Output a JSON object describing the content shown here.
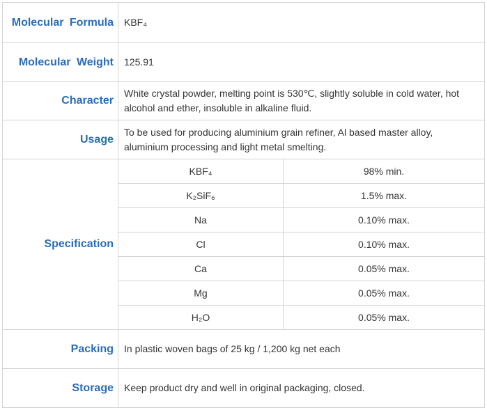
{
  "rows": {
    "formula": {
      "label": "Molecular  Formula",
      "value": "KBF₄"
    },
    "weight": {
      "label": "Molecular  Weight",
      "value": "125.91"
    },
    "character": {
      "label": "Character",
      "value": "White crystal powder, melting point is 530℃, slightly soluble in cold water, hot alcohol and ether, insoluble in alkaline fluid."
    },
    "usage": {
      "label": "Usage",
      "value": "To be used for producing aluminium grain refiner, Al based master alloy, aluminium processing and light metal smelting."
    },
    "specification": {
      "label": "Specification",
      "items": [
        {
          "name": "KBF₄",
          "value": "98% min."
        },
        {
          "name": "K₂SiF₆",
          "value": "1.5% max."
        },
        {
          "name": "Na",
          "value": "0.10% max."
        },
        {
          "name": "Cl",
          "value": "0.10% max."
        },
        {
          "name": "Ca",
          "value": "0.05% max."
        },
        {
          "name": "Mg",
          "value": "0.05% max."
        },
        {
          "name": "H₂O",
          "value": "0.05% max."
        }
      ]
    },
    "packing": {
      "label": "Packing",
      "value": "In plastic woven bags of 25 kg / 1,200 kg net each"
    },
    "storage": {
      "label": "Storage",
      "value": "Keep product dry and well in original packaging, closed."
    }
  }
}
